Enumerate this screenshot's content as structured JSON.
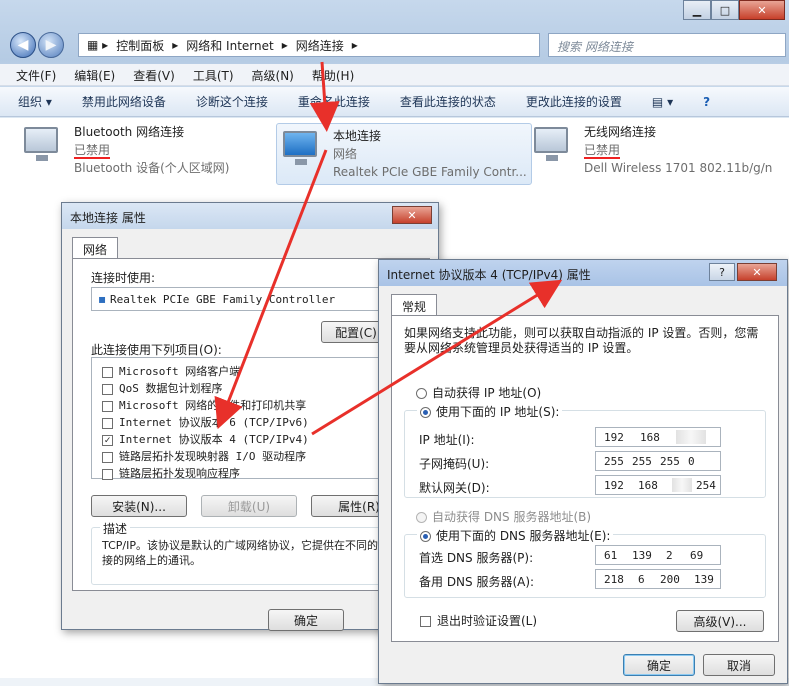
{
  "explorer": {
    "breadcrumb": [
      "控制面板",
      "网络和 Internet",
      "网络连接"
    ],
    "search_placeholder": "搜索 网络连接",
    "menu": [
      "文件(F)",
      "编辑(E)",
      "查看(V)",
      "工具(T)",
      "高级(N)",
      "帮助(H)"
    ],
    "commands": [
      "组织 ▾",
      "禁用此网络设备",
      "诊断这个连接",
      "重命名此连接",
      "查看此连接的状态",
      "更改此连接的设置"
    ],
    "connections": [
      {
        "name": "Bluetooth 网络连接",
        "status": "已禁用",
        "device": "Bluetooth 设备(个人区域网)"
      },
      {
        "name": "本地连接",
        "status": "网络",
        "device": "Realtek PCIe GBE Family Contr..."
      },
      {
        "name": "无线网络连接",
        "status": "已禁用",
        "device": "Dell Wireless 1701 802.11b/g/n"
      }
    ]
  },
  "lan_dialog": {
    "title": "本地连接 属性",
    "tab": "网络",
    "connect_using_label": "连接时使用:",
    "adapter": "Realtek PCIe GBE Family Controller",
    "configure_button": "配置(C)",
    "items_label": "此连接使用下列项目(O):",
    "items": [
      {
        "label": "Microsoft 网络客户端",
        "checked": false
      },
      {
        "label": "QoS 数据包计划程序",
        "checked": false
      },
      {
        "label": "Microsoft 网络的文件和打印机共享",
        "checked": false
      },
      {
        "label": "Internet 协议版本 6 (TCP/IPv6)",
        "checked": false
      },
      {
        "label": "Internet 协议版本 4 (TCP/IPv4)",
        "checked": true
      },
      {
        "label": "链路层拓扑发现映射器 I/O 驱动程序",
        "checked": false
      },
      {
        "label": "链路层拓扑发现响应程序",
        "checked": false
      }
    ],
    "install_button": "安装(N)...",
    "uninstall_button": "卸载(U)",
    "properties_button": "属性(R)",
    "description_label": "描述",
    "description_text": "TCP/IP。该协议是默认的广域网络协议，它提供在不同的相互连接的网络上的通讯。",
    "ok_button": "确定"
  },
  "ipv4_dialog": {
    "title": "Internet 协议版本 4 (TCP/IPv4) 属性",
    "help": "?",
    "tab": "常规",
    "intro": "如果网络支持此功能，则可以获取自动指派的 IP 设置。否则，您需要从网络系统管理员处获得适当的 IP 设置。",
    "auto_ip": "自动获得 IP 地址(O)",
    "manual_ip": "使用下面的 IP 地址(S):",
    "ip_label": "IP 地址(I):",
    "ip_value": [
      "192",
      "168"
    ],
    "mask_label": "子网掩码(U):",
    "mask_value": [
      "255",
      "255",
      "255",
      "0"
    ],
    "gateway_label": "默认网关(D):",
    "gateway_value": [
      "192",
      "168",
      "254"
    ],
    "auto_dns": "自动获得 DNS 服务器地址(B)",
    "manual_dns": "使用下面的 DNS 服务器地址(E):",
    "dns1_label": "首选 DNS 服务器(P):",
    "dns1_value": [
      "61",
      "139",
      "2",
      "69"
    ],
    "dns2_label": "备用 DNS 服务器(A):",
    "dns2_value": [
      "218",
      "6",
      "200",
      "139"
    ],
    "validate_label": "退出时验证设置(L)",
    "advanced_button": "高级(V)...",
    "ok_button": "确定",
    "cancel_button": "取消"
  },
  "colors": {
    "annotation_red": "#e8302a"
  }
}
